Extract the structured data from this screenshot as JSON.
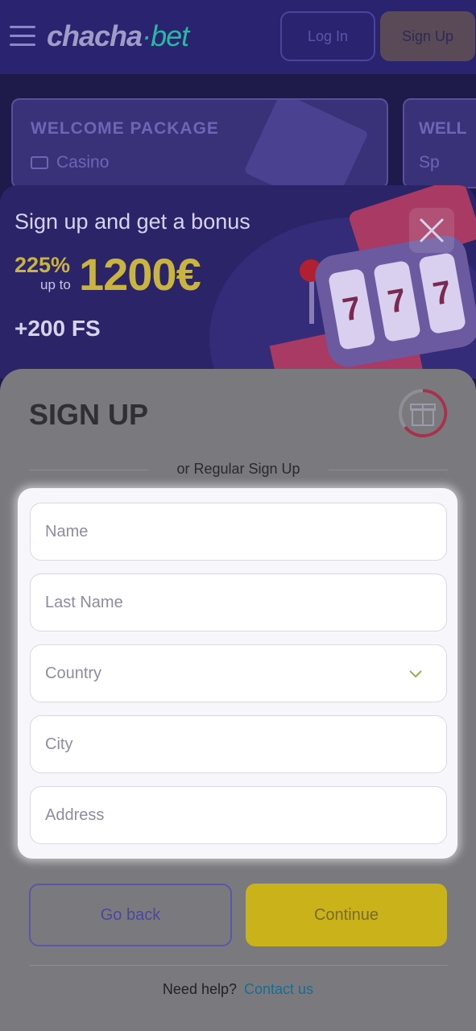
{
  "header": {
    "logo_main": "chacha",
    "logo_suffix": "·bet",
    "login_label": "Log In",
    "signup_label": "Sign Up"
  },
  "promos": [
    {
      "title": "WELCOME PACKAGE",
      "subtitle": "Casino"
    },
    {
      "title": "WELL",
      "subtitle": "Sp"
    }
  ],
  "bonus": {
    "title": "Sign up and get a bonus",
    "percent": "225%",
    "up_to": "up to",
    "amount": "1200€",
    "free_spins": "+200 FS"
  },
  "signup": {
    "title": "SIGN UP",
    "divider_text": "or Regular Sign Up",
    "fields": {
      "name": "Name",
      "last_name": "Last Name",
      "country": "Country",
      "city": "City",
      "address": "Address"
    },
    "go_back_label": "Go back",
    "continue_label": "Continue",
    "help_text": "Need help?",
    "contact_label": "Contact us"
  },
  "colors": {
    "accent_yellow": "#c9b21a",
    "accent_purple": "#2a2470",
    "link": "#1a6c8e"
  }
}
